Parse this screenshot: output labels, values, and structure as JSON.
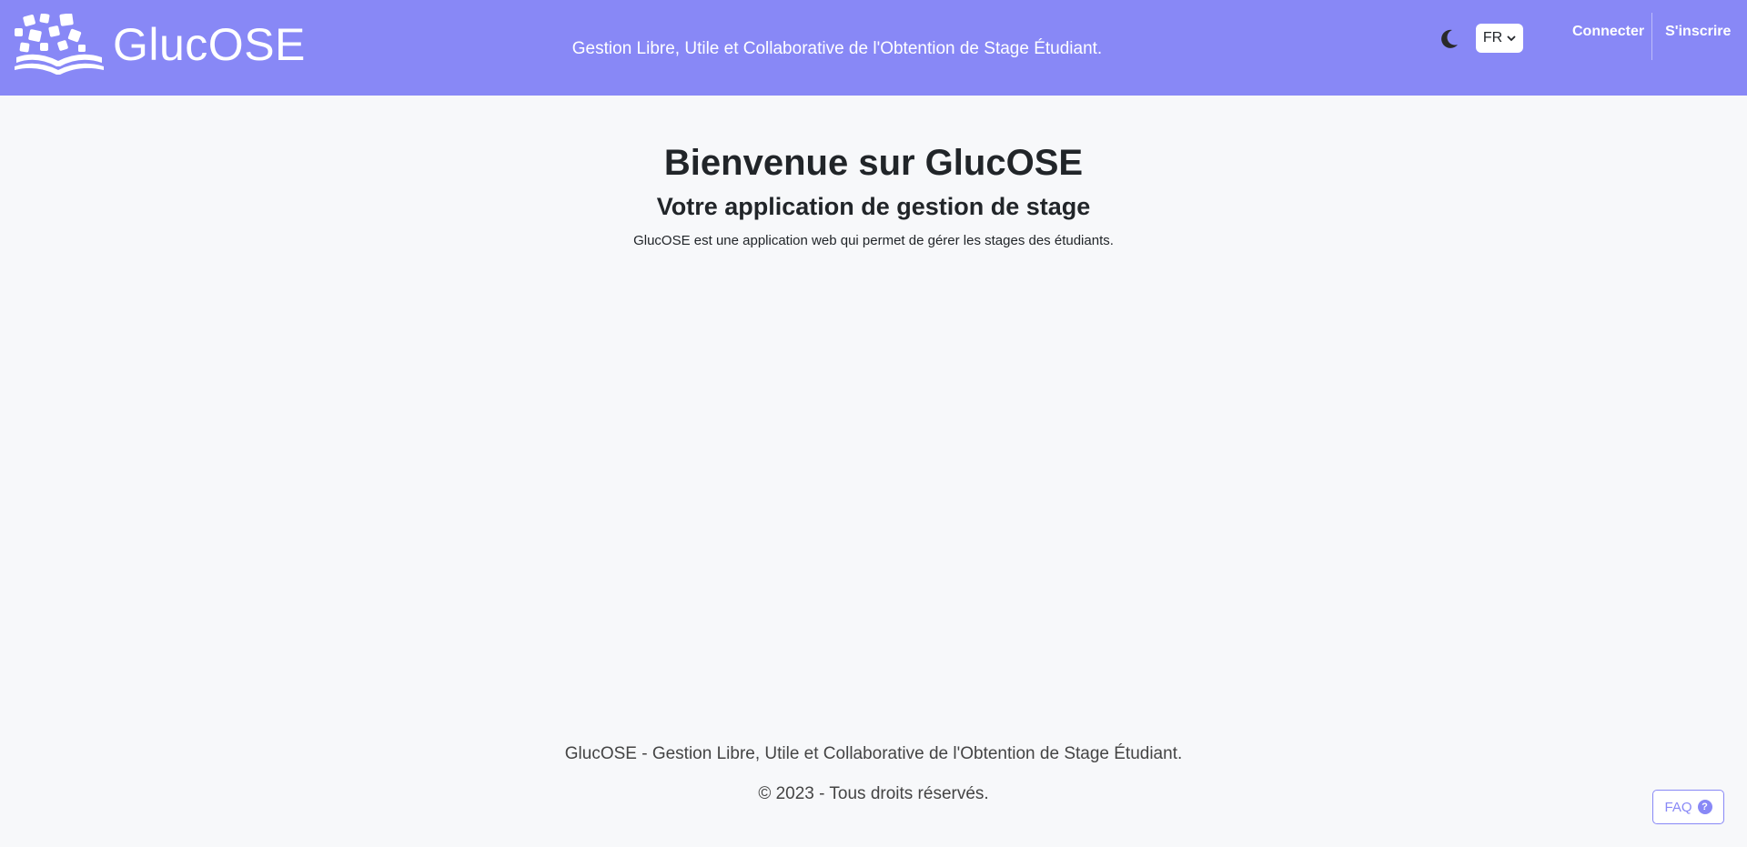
{
  "header": {
    "brand_name": "GlucOSE",
    "tagline": "Gestion Libre, Utile et Collaborative de l'Obtention de Stage Étudiant.",
    "theme_toggle_icon": "moon-icon",
    "language": {
      "selected": "FR"
    },
    "nav": {
      "login_label": "Connecter",
      "signup_label": "S'inscrire"
    }
  },
  "main": {
    "title": "Bienvenue sur GlucOSE",
    "subtitle": "Votre application de gestion de stage",
    "description": "GlucOSE est une application web qui permet de gérer les stages des étudiants."
  },
  "footer": {
    "line1": "GlucOSE - Gestion Libre, Utile et Collaborative de l'Obtention de Stage Étudiant.",
    "line2": "© 2023 - Tous droits réservés."
  },
  "faq": {
    "label": "FAQ",
    "icon_glyph": "?"
  },
  "colors": {
    "primary": "#8888f6",
    "background": "#f7f8fa",
    "text": "#212529"
  }
}
